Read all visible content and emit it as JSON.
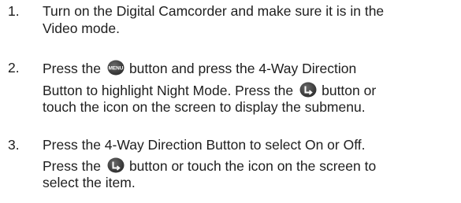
{
  "steps": [
    {
      "number": "1.",
      "line1": "Turn on the Digital Camcorder and make sure it is in the",
      "line2": "Video mode."
    },
    {
      "number": "2.",
      "line1_pre": "Press the",
      "menu_icon_label": "MENU",
      "line1_post": "button and press the 4-Way Direction",
      "line2_pre": "Button to highlight Night Mode. Press the",
      "line2_post": "button or",
      "line3": "touch the icon on the screen to display the submenu."
    },
    {
      "number": "3.",
      "line1": "Press the 4-Way Direction Button to select On or Off.",
      "line2_pre": "Press the",
      "line2_post": "button or touch the icon on the screen to",
      "line3": "select the item."
    }
  ],
  "icons": {
    "menu_button": "menu-button-icon",
    "ok_button": "ok-button-icon",
    "color": "#3a3a3a"
  }
}
